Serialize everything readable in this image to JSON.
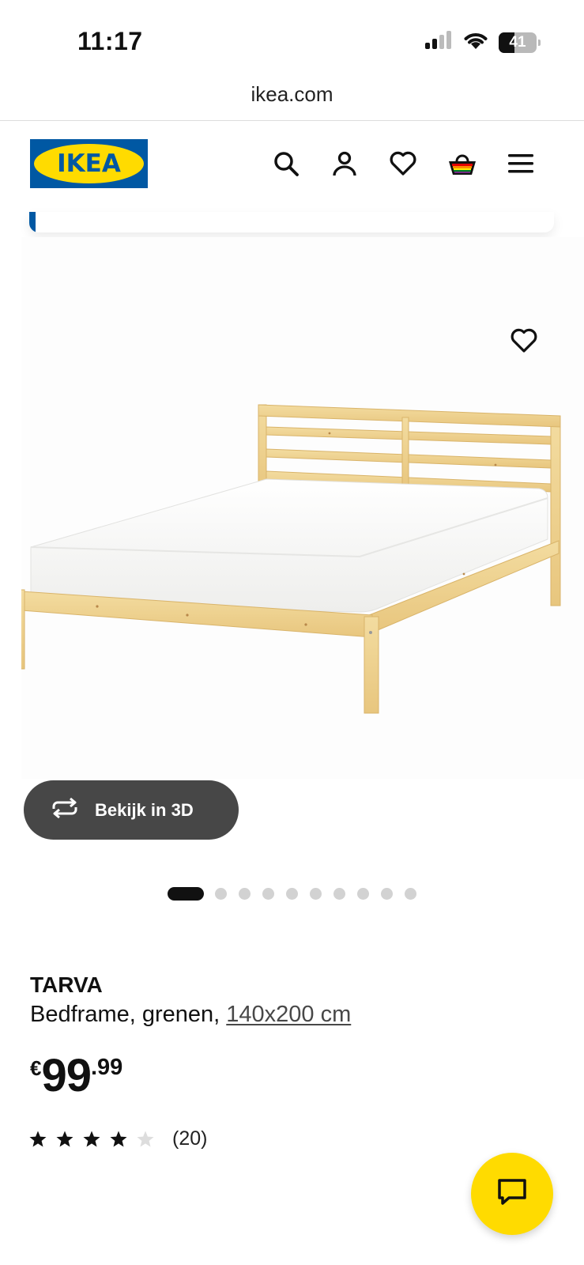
{
  "status_bar": {
    "time": "11:17",
    "battery": "41",
    "battery_level_percent": 41
  },
  "browser": {
    "url": "ikea.com"
  },
  "header": {
    "logo_text": "IKEA",
    "icons": [
      "search-icon",
      "account-icon",
      "heart-icon",
      "basket-icon",
      "menu-icon"
    ]
  },
  "product": {
    "name": "TARVA",
    "description": "Bedframe, grenen, ",
    "size_link": "140x200 cm",
    "price": {
      "currency": "€",
      "integer": "99",
      "separator": ".",
      "decimal": "99"
    },
    "rating": {
      "stars": 4,
      "max_stars": 5,
      "review_count": "(20)"
    }
  },
  "gallery": {
    "view_3d_label": "Bekijk in 3D",
    "image_count": 10,
    "active_index": 0
  },
  "colors": {
    "ikea_blue": "#0058a3",
    "ikea_yellow": "#ffdb00",
    "view3d_bg": "#474747",
    "star_filled": "#111111",
    "star_empty": "#dddddd"
  }
}
